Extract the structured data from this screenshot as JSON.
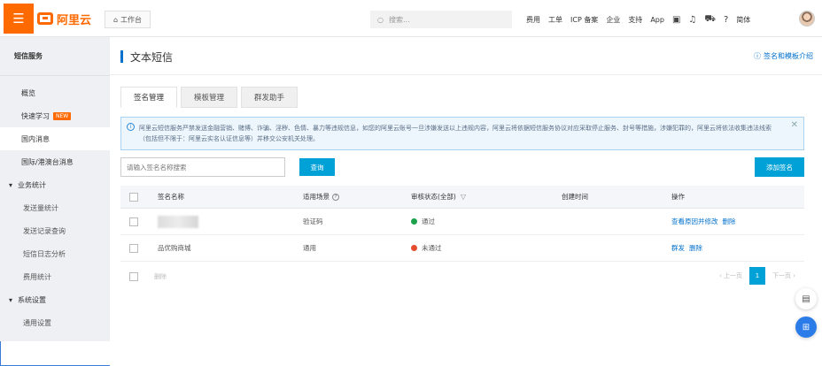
{
  "topbar": {
    "logo_text": "阿里云",
    "workbench": "工作台",
    "search_placeholder": "搜索...",
    "links": [
      "费用",
      "工单",
      "ICP 备案",
      "企业",
      "支持",
      "App"
    ],
    "language": "简体"
  },
  "sidebar": {
    "title": "短信服务",
    "items": [
      {
        "label": "概览",
        "active": false
      },
      {
        "label": "快速学习",
        "badge": "NEW",
        "active": false
      },
      {
        "label": "国内消息",
        "active": true
      },
      {
        "label": "国际/港澳台消息",
        "active": false
      }
    ],
    "group_stats": "业务统计",
    "stats_items": [
      "发送量统计",
      "发送记录查询",
      "短信日志分析",
      "费用统计"
    ],
    "group_settings": "系统设置",
    "settings_items": [
      "通用设置"
    ]
  },
  "main": {
    "title": "文本短信",
    "help_link": "签名和模板介绍",
    "tabs": [
      {
        "label": "签名管理",
        "active": true
      },
      {
        "label": "模板管理",
        "active": false
      },
      {
        "label": "群发助手",
        "active": false
      }
    ],
    "notice": "阿里云短信服务严禁发送金融营销、赌博、诈骗、淫秽、色情、暴力等违规信息，如您的阿里云账号一旦涉嫌发送以上违规内容，阿里云将依据短信服务协议对应采取停止服务、封号等措施，涉嫌犯罪的，阿里云将依法收集违法线索（包括但不限于：阿里云实名认证信息等）并移交公安机关处理。",
    "search_placeholder": "请输入签名名称搜索",
    "query_button": "查询",
    "add_button": "添加签名",
    "columns": {
      "name": "签名名称",
      "scene": "适用场景",
      "status": "审核状态(全部)",
      "time": "创建时间",
      "ops": "操作"
    },
    "rows": [
      {
        "name": "",
        "scene": "验证码",
        "status": "通过",
        "status_color": "#1aa14a",
        "time": "",
        "ops": [
          "查看原因并修改",
          "删除"
        ]
      },
      {
        "name": "品优购商城",
        "scene": "通用",
        "status": "未通过",
        "status_color": "#e54c2d",
        "time": "",
        "ops": [
          "群发",
          "删除"
        ]
      }
    ],
    "batch_delete": "删除",
    "pager": {
      "prev": "上一页",
      "current": "1",
      "next": "下一页"
    }
  },
  "colors": {
    "brand": "#ff6a00",
    "accent": "#00a1d6",
    "link": "#0070cc"
  }
}
